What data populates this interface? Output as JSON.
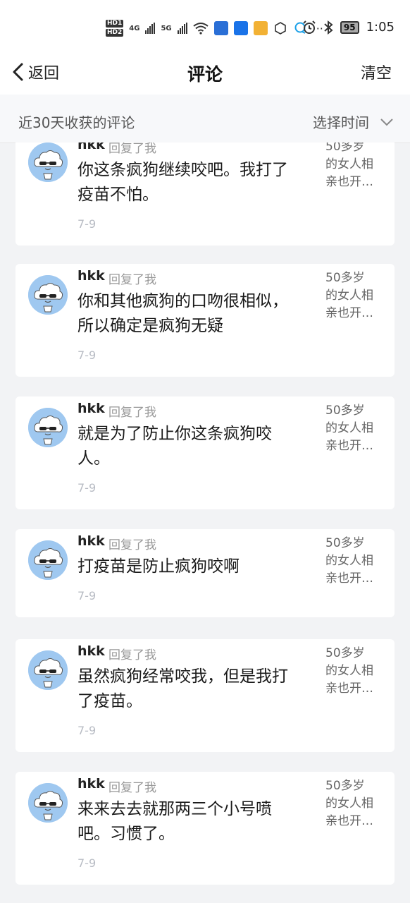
{
  "status_bar": {
    "hd1": "HD1",
    "hd2": "HD2",
    "net1": "4G",
    "net2": "5G",
    "battery": "95",
    "time": "1:05",
    "more": "···"
  },
  "nav": {
    "back_label": "返回",
    "title": "评论",
    "clear_label": "清空"
  },
  "filter": {
    "label": "近30天收获的评论",
    "time_select": "选择时间"
  },
  "comments": [
    {
      "user": "hkk",
      "action": "回复了我",
      "lines": [
        "你这条疯狗继续咬吧。我打了",
        "疫苗不怕。"
      ],
      "date": "7-9",
      "ref": [
        "50多岁",
        "的女人相",
        "亲也开…"
      ]
    },
    {
      "user": "hkk",
      "action": "回复了我",
      "lines": [
        "你和其他疯狗的口吻很相似，",
        "所以确定是疯狗无疑"
      ],
      "date": "7-9",
      "ref": [
        "50多岁",
        "的女人相",
        "亲也开…"
      ]
    },
    {
      "user": "hkk",
      "action": "回复了我",
      "lines": [
        "就是为了防止你这条疯狗咬",
        "人。"
      ],
      "date": "7-9",
      "ref": [
        "50多岁",
        "的女人相",
        "亲也开…"
      ]
    },
    {
      "user": "hkk",
      "action": "回复了我",
      "lines": [
        "打疫苗是防止疯狗咬啊"
      ],
      "date": "7-9",
      "ref": [
        "50多岁",
        "的女人相",
        "亲也开…"
      ]
    },
    {
      "user": "hkk",
      "action": "回复了我",
      "lines": [
        "虽然疯狗经常咬我，但是我打",
        "了疫苗。"
      ],
      "date": "7-9",
      "ref": [
        "50多岁",
        "的女人相",
        "亲也开…"
      ]
    },
    {
      "user": "hkk",
      "action": "回复了我",
      "lines": [
        "来来去去就那两三个小号喷",
        "吧。习惯了。"
      ],
      "date": "7-9",
      "ref": [
        "50多岁",
        "的女人相",
        "亲也开…"
      ]
    }
  ],
  "colors": {
    "background": "#f2f3f5",
    "card": "#ffffff",
    "avatar_bg": "#9fc8f0",
    "muted": "#999999",
    "date": "#b8bcc4"
  },
  "icons": [
    "back-chevron-icon",
    "chevron-down-icon",
    "alarm-icon",
    "bluetooth-icon",
    "wifi-icon",
    "signal-icon",
    "battery-icon"
  ]
}
